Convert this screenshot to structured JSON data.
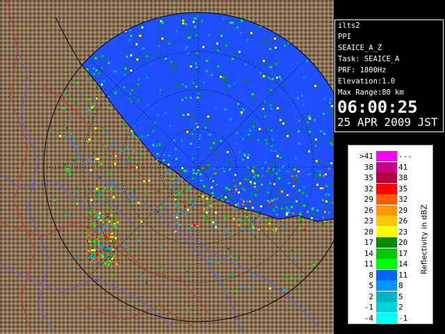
{
  "info": {
    "site": "ilts2",
    "mode": "PPI",
    "product": "SEAICE_A_Z",
    "task": "Task: SEAICE_A",
    "prf": "PRF: 1800Hz",
    "elevation": "Elevation:1.0",
    "max_range": "Max Range:80 km",
    "time": "06:00:25",
    "date": "25 APR 2009 JST"
  },
  "legend": {
    "axis_label": "Reflectivity in dBZ",
    "rows": [
      {
        "low": ">41",
        "high": "---",
        "color": "#ff00ff"
      },
      {
        "low": "38",
        "high": "41",
        "color": "#c8008c"
      },
      {
        "low": "35",
        "high": "38",
        "color": "#b4003c"
      },
      {
        "low": "32",
        "high": "35",
        "color": "#ff0000"
      },
      {
        "low": "29",
        "high": "32",
        "color": "#ff5a00"
      },
      {
        "low": "26",
        "high": "29",
        "color": "#ff9600"
      },
      {
        "low": "23",
        "high": "26",
        "color": "#ffc800"
      },
      {
        "low": "20",
        "high": "23",
        "color": "#ffff00"
      },
      {
        "low": "17",
        "high": "20",
        "color": "#008c00"
      },
      {
        "low": "14",
        "high": "17",
        "color": "#00c800"
      },
      {
        "low": "11",
        "high": "14",
        "color": "#00ff00"
      },
      {
        "low": "8",
        "high": "11",
        "color": "#0064ff"
      },
      {
        "low": "5",
        "high": "8",
        "color": "#0096ff"
      },
      {
        "low": "2",
        "high": "5",
        "color": "#00b4c8"
      },
      {
        "low": "-1",
        "high": "2",
        "color": "#00d2dc"
      },
      {
        "low": "-4",
        "high": "-1",
        "color": "#00ffff"
      }
    ]
  },
  "colors": {
    "sea": "#1e50ff",
    "land": "#8c7450",
    "rivers": "#5050ff",
    "boundaries": "#d23232",
    "range_rings": "#000000"
  }
}
